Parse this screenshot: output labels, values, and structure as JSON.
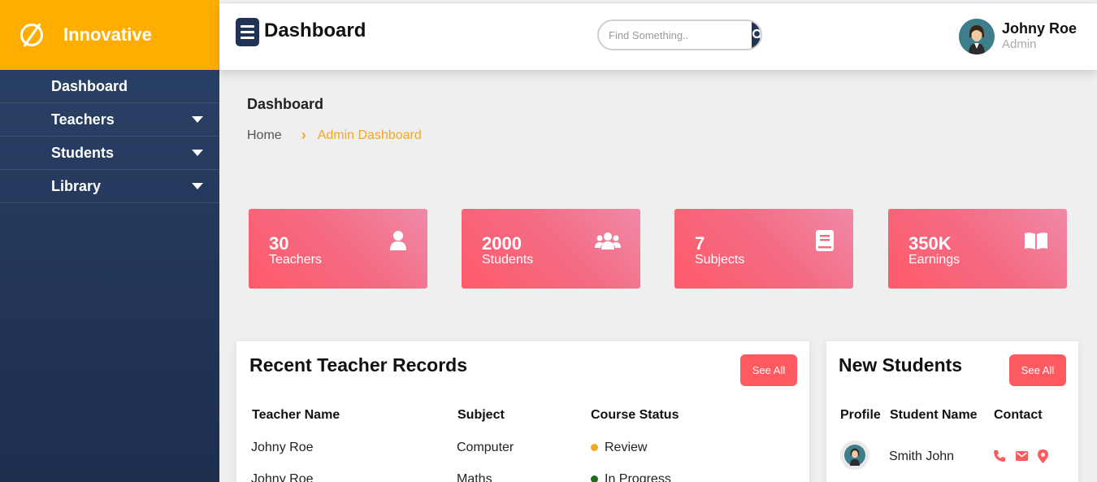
{
  "brand": {
    "name": "Innovative",
    "accent": "#ffad00"
  },
  "sidebar": {
    "items": [
      {
        "label": "Dashboard",
        "has_caret": false
      },
      {
        "label": "Teachers",
        "has_caret": true
      },
      {
        "label": "Students",
        "has_caret": true
      },
      {
        "label": "Library",
        "has_caret": true
      }
    ]
  },
  "header": {
    "title": "Dashboard",
    "search": {
      "placeholder": "Find Something..",
      "value": ""
    },
    "user": {
      "name": "Johny Roe",
      "role": "Admin"
    }
  },
  "page": {
    "title": "Dashboard",
    "breadcrumb": {
      "home": "Home",
      "current": "Admin Dashboard"
    }
  },
  "stats": [
    {
      "value": "30",
      "label": "Teachers",
      "icon": "user-icon"
    },
    {
      "value": "2000",
      "label": "Students",
      "icon": "users-icon"
    },
    {
      "value": "7",
      "label": "Subjects",
      "icon": "book-icon"
    },
    {
      "value": "350K",
      "label": "Earnings",
      "icon": "open-book-icon"
    }
  ],
  "teacher_records": {
    "title": "Recent Teacher Records",
    "see_all": "See All",
    "columns": [
      "Teacher Name",
      "Subject",
      "Course Status"
    ],
    "rows": [
      {
        "name": "Johny Roe",
        "subject": "Computer",
        "status": "Review",
        "status_color": "#f5a623"
      },
      {
        "name": "Johny Roe",
        "subject": "Maths",
        "status": "In Progress",
        "status_color": "#1e6b1e"
      }
    ]
  },
  "new_students": {
    "title": "New Students",
    "see_all": "See All",
    "columns": [
      "Profile",
      "Student Name",
      "Contact"
    ],
    "rows": [
      {
        "name": "Smith John",
        "contact_icons": [
          "phone-icon",
          "mail-icon",
          "location-icon"
        ]
      }
    ]
  },
  "colors": {
    "navy": "#213456",
    "coral": "#ff5a5f",
    "orange": "#f5a623"
  }
}
